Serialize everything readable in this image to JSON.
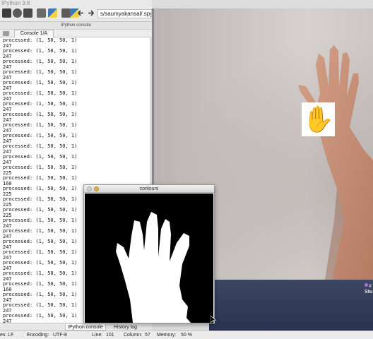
{
  "app": {
    "title": "IPython 3.6"
  },
  "toolbar": {
    "path": "s/saumyakansal/.spyder",
    "icons": [
      "stop-icon",
      "info-icon",
      "grid-icon",
      "settings-icon",
      "python-icon",
      "wrench-icon",
      "python-path-icon",
      "back-arrow-icon",
      "forward-arrow-icon"
    ]
  },
  "console": {
    "header": "IPython console",
    "tab_label": "Console 1/A",
    "lines": [
      "processed: (1, 50, 50, 1)",
      "247",
      "processed: (1, 50, 50, 1)",
      "247",
      "processed: (1, 50, 50, 1)",
      "247",
      "processed: (1, 50, 50, 1)",
      "247",
      "processed: (1, 50, 50, 1)",
      "247",
      "processed: (1, 50, 50, 1)",
      "247",
      "processed: (1, 50, 50, 1)",
      "247",
      "processed: (1, 50, 50, 1)",
      "247",
      "processed: (1, 50, 50, 1)",
      "247",
      "processed: (1, 50, 50, 1)",
      "247",
      "processed: (1, 50, 50, 1)",
      "247",
      "processed: (1, 50, 50, 1)",
      "247",
      "processed: (1, 50, 50, 1)",
      "225",
      "processed: (1, 50, 50, 1)",
      "160",
      "processed: (1, 50, 50, 1)",
      "225",
      "processed: (1, 50, 50, 1)",
      "225",
      "processed: (1, 50, 50, 1)",
      "225",
      "processed: (1, 50, 50, 1)",
      "247",
      "processed: (1, 50, 50, 1)",
      "247",
      "processed: (1, 50, 50, 1)",
      "247",
      "processed: (1, 50, 50, 1)",
      "247",
      "processed: (1, 50, 50, 1)",
      "247",
      "processed: (1, 50, 50, 1)",
      "247",
      "processed: (1, 50, 50, 1)",
      "160",
      "processed: (1, 50, 50, 1)",
      "247",
      "processed: (1, 50, 50, 1)",
      "247",
      "processed: (1, 50, 50, 1)",
      "247",
      "processed: (1, 50, 50, 1)",
      "247",
      "processed: (1, 50, 50, 1)",
      "247",
      "processed: (1, 50, 50, 1)",
      "247"
    ]
  },
  "bottom_tabs": {
    "ipython": "IPython console",
    "history": "History log"
  },
  "status": {
    "eol": "es: LF",
    "encoding_label": "Encoding:",
    "encoding_value": "UTF-8",
    "line_label": "Line:",
    "line_value": "101",
    "column_label": "Column:",
    "column_value": "57",
    "memory_label": "Memory:",
    "memory_value": "50 %"
  },
  "contours": {
    "title": "contours"
  },
  "webcam": {
    "emoji": "✋",
    "desktop_label_1": "#",
    "desktop_label_2": "Stu"
  },
  "colors": {
    "traffic_red": "#e8685a",
    "traffic_yellow": "#e0b04a",
    "traffic_green": "#6abf5a"
  }
}
